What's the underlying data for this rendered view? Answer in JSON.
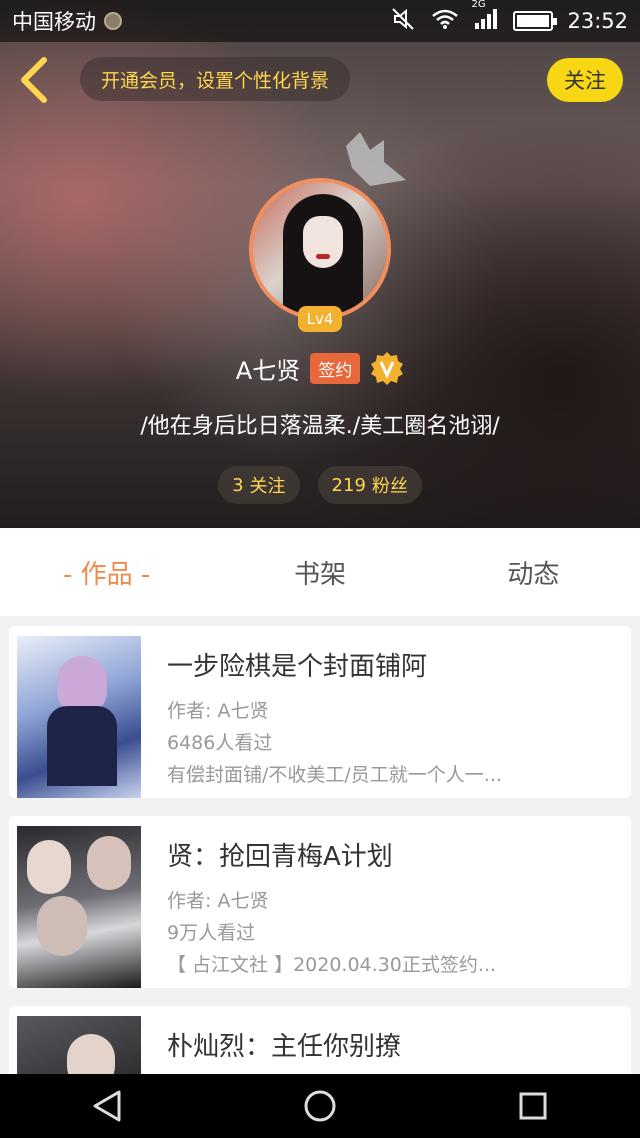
{
  "status_bar": {
    "carrier": "中国移动",
    "network": "2G",
    "time": "23:52"
  },
  "header": {
    "vip_prompt": "开通会员，设置个性化背景",
    "follow_label": "关注",
    "level": "Lv4",
    "name": "A七贤",
    "sign_badge": "签约",
    "bio": "/他在身后比日落温柔./美工圈名池诩/",
    "following_count": "3",
    "following_label": "关注",
    "fans_count": "219",
    "fans_label": "粉丝"
  },
  "tabs": [
    {
      "label": "- 作品 -",
      "active": true
    },
    {
      "label": "书架",
      "active": false
    },
    {
      "label": "动态",
      "active": false
    }
  ],
  "works": [
    {
      "title": "一步险棋是个封面铺阿",
      "author": "作者: A七贤",
      "views": "6486人看过",
      "desc": "有偿封面铺/不收美工/员工就一个人一..."
    },
    {
      "title": "贤：抢回青梅A计划",
      "author": "作者: A七贤",
      "views": "9万人看过",
      "desc": "【 占江文社 】2020.04.30正式签约..."
    },
    {
      "title": "朴灿烈：主任你别撩",
      "author": "",
      "views": "",
      "desc": ""
    }
  ],
  "colors": {
    "accent": "#f08a4b",
    "follow_button": "#f7d614",
    "stat_text": "#ffd64d",
    "sign_badge": "#e8683c"
  }
}
